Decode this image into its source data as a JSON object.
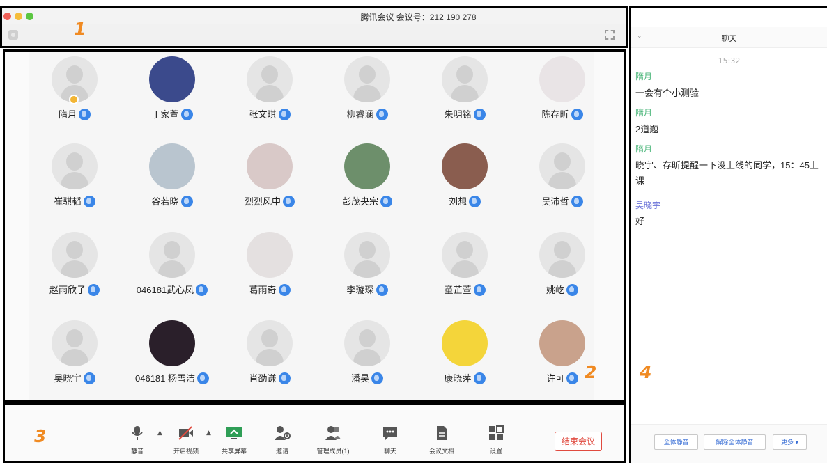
{
  "window": {
    "title": "腾讯会议 会议号：212 190 278"
  },
  "annotations": [
    "1",
    "2",
    "3",
    "4"
  ],
  "participants": [
    {
      "name": "隋月",
      "avatar": "default",
      "host": true
    },
    {
      "name": "丁家萱",
      "avatar": "photo",
      "color": "#3b4a8c"
    },
    {
      "name": "张文琪",
      "avatar": "default"
    },
    {
      "name": "柳睿涵",
      "avatar": "default"
    },
    {
      "name": "朱明铭",
      "avatar": "default"
    },
    {
      "name": "陈存昕",
      "avatar": "photo",
      "color": "#e9e4e6"
    },
    {
      "name": "崔骐韬",
      "avatar": "default"
    },
    {
      "name": "谷若晓",
      "avatar": "photo",
      "color": "#b9c5cf"
    },
    {
      "name": "烈烈风中",
      "avatar": "photo",
      "color": "#d9c9c8"
    },
    {
      "name": "彭茂央宗",
      "avatar": "photo",
      "color": "#6d8f6b"
    },
    {
      "name": "刘想",
      "avatar": "photo",
      "color": "#8a5d4f"
    },
    {
      "name": "吴沛哲",
      "avatar": "default"
    },
    {
      "name": "赵雨欣子",
      "avatar": "default"
    },
    {
      "name": "046181武心凤",
      "avatar": "default"
    },
    {
      "name": "葛雨奇",
      "avatar": "photo",
      "color": "#e4e0e0"
    },
    {
      "name": "李璇琛",
      "avatar": "default"
    },
    {
      "name": "童芷萱",
      "avatar": "default"
    },
    {
      "name": "姚屹",
      "avatar": "default"
    },
    {
      "name": "吴晓宇",
      "avatar": "default"
    },
    {
      "name": "046181 杨雪洁",
      "avatar": "photo",
      "color": "#2a1f2a"
    },
    {
      "name": "肖劭谦",
      "avatar": "default"
    },
    {
      "name": "潘昊",
      "avatar": "default"
    },
    {
      "name": "康晓萍",
      "avatar": "photo",
      "color": "#f4d53a"
    },
    {
      "name": "许可",
      "avatar": "photo",
      "color": "#c9a28c"
    }
  ],
  "toolbar": {
    "mute": "静音",
    "video": "开启视频",
    "share": "共享屏幕",
    "invite": "邀请",
    "members": "管理成员(1)",
    "chat": "聊天",
    "docs": "会议文档",
    "settings": "设置",
    "end": "结束会议"
  },
  "chat": {
    "title": "聊天",
    "time": "15:32",
    "messages": [
      {
        "sender": "隋月",
        "text": "一会有个小测验"
      },
      {
        "sender": "隋月",
        "text": "2道题"
      },
      {
        "sender": "隋月",
        "text": "晓宇、存昕提醒一下没上线的同学，15：45上课"
      },
      {
        "sender": "吴晓宇",
        "text": "好"
      }
    ],
    "footer": {
      "mute_all": "全体静音",
      "unmute_all": "解除全体静音",
      "more": "更多 ▾"
    }
  },
  "colors": {
    "accent_blue": "#3a86e8",
    "end_red": "#e04a3f",
    "chat_green": "#4bb67a",
    "chat_purple": "#6a72d8",
    "annotation_orange": "#f08a22"
  }
}
